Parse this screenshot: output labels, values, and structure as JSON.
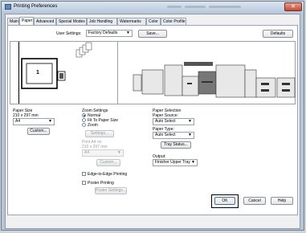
{
  "window": {
    "title": "Printing Preferences",
    "close_glyph": "✕"
  },
  "tabs": [
    "Main",
    "Paper",
    "Advanced",
    "Special Modes",
    "Job Handling",
    "Watermarks",
    "Color",
    "Color Profile"
  ],
  "active_tab": "Paper",
  "settings": {
    "label": "User Settings:",
    "value": "Factory Defaults",
    "save": "Save...",
    "defaults": "Defaults"
  },
  "preview": {
    "page_number": "1"
  },
  "paper_size": {
    "title": "Paper Size",
    "dimension": "210 x 297 mm",
    "value": "A4",
    "custom": "Custom..."
  },
  "zoom": {
    "title": "Zoom Settings",
    "normal": "Normal",
    "fit": "Fit To Paper Size",
    "zoom": "Zoom",
    "settings": "Settings...",
    "print_on_label": "Print A4 on:",
    "print_on_dim": "210 x 297 mm",
    "print_on_value": "A4",
    "custom": "Custom..."
  },
  "edge_to_edge": "Edge-to-Edge Printing",
  "poster": {
    "label": "Poster Printing",
    "settings": "Poster Settings..."
  },
  "paper_selection": {
    "title": "Paper Selection",
    "source_label": "Paper Source:",
    "source_value": "Auto Select",
    "type_label": "Paper Type:",
    "type_value": "Auto Select",
    "tray_status": "Tray Status...",
    "output_label": "Output:",
    "output_value": "Finisher Upper Tray"
  },
  "footer": {
    "ok": "OK",
    "cancel": "Cancel",
    "help": "Help"
  },
  "colors": {
    "highlight": "#000000",
    "accent": "#1c3f7a"
  }
}
